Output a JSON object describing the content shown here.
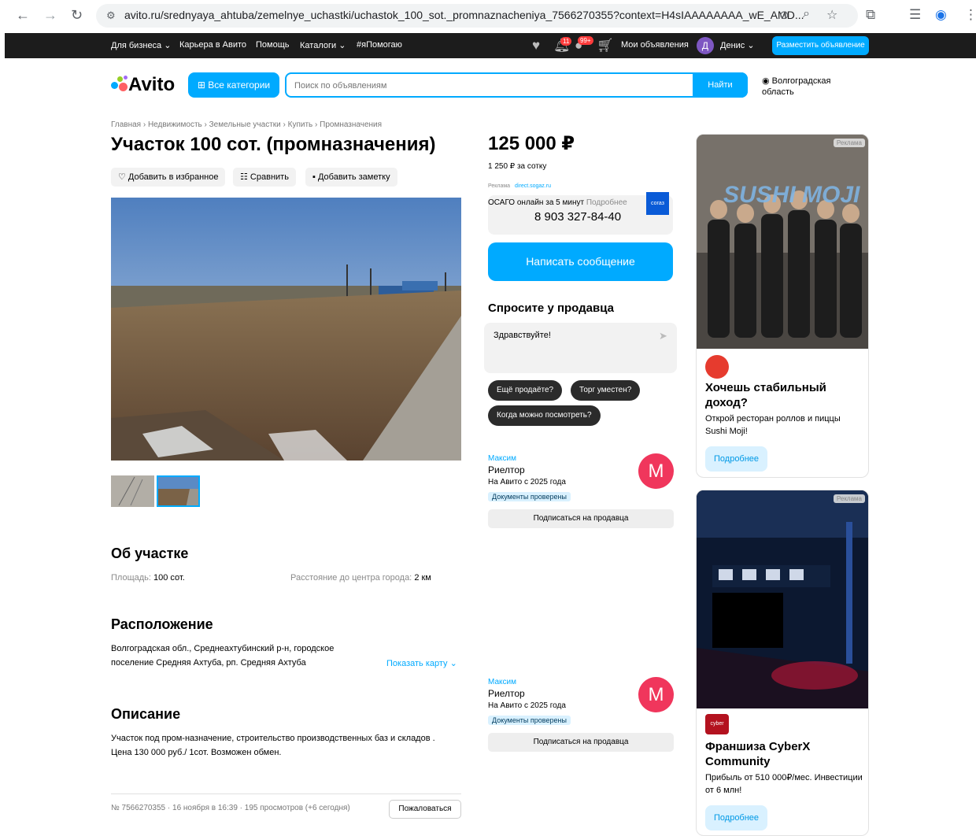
{
  "browser": {
    "url": "avito.ru/srednyaya_ahtuba/zemelnye_uchastki/uchastok_100_sot._promnaznacheniya_7566270355?context=H4sIAAAAAAAA_wE_AMD..."
  },
  "topbar": {
    "items": [
      "Для бизнеса ⌄",
      "Карьера в Авито",
      "Помощь",
      "Каталоги ⌄",
      "#яПомогаю"
    ],
    "notif_badge": "11",
    "msg_badge": "99+",
    "my_ads": "Мои объявления",
    "avatar_letter": "Д",
    "user": "Денис ⌄",
    "post_button": "Разместить объявление"
  },
  "header": {
    "logo": "Avito",
    "categories_button": "Все категории",
    "search_placeholder": "Поиск по объявлениям",
    "search_button": "Найти",
    "region": "Волгоградская область"
  },
  "listing": {
    "breadcrumb": "Главная › Недвижимость › Земельные участки › Купить › Промназначения",
    "title": "Участок 100 сот. (промназначения)",
    "actions": [
      "Добавить в избранное",
      "Сравнить",
      "Добавить заметку"
    ],
    "about_title": "Об участке",
    "area_label": "Площадь:",
    "area_value": "100 сот.",
    "distance_label": "Расстояние до центра города:",
    "distance_value": "2 км",
    "location_title": "Расположение",
    "address": "Волгоградская обл., Среднеахтубинский р-н, городское поселение Средняя Ахтуба, рп. Средняя Ахтуба",
    "show_map": "Показать карту ⌄",
    "description_title": "Описание",
    "description": "Участок под пром-назначение, строительство производственных баз и складов . Цена 130 000 руб./ 1сот. Возможен обмен.",
    "meta": "№ 7566270355 · 16 ноября в 16:39 · 195 просмотров (+6 сегодня)",
    "complain": "Пожаловаться"
  },
  "price": {
    "value": "125 000 ₽",
    "per_unit": "1 250 ₽ за сотку",
    "ad_label": "Реклама",
    "ad_domain": "direct.sogaz.ru",
    "ad_text": "ОСАГО онлайн за 5 минут",
    "ad_more": "Подробнее",
    "ad_logo": "согаз",
    "phone": "8 903 327-84-40",
    "message_button": "Написать сообщение",
    "ask_title": "Спросите у продавца",
    "ask_placeholder": "Здравствуйте!",
    "chips": [
      "Ещё продаёте?",
      "Торг уместен?",
      "Когда можно посмотреть?"
    ]
  },
  "seller": {
    "name": "Максим",
    "role": "Риелтор",
    "since": "На Авито с 2025 года",
    "docs": "Документы проверены",
    "avatar": "M",
    "subscribe": "Подписаться на продавца"
  },
  "ads": [
    {
      "tag": "Реклама",
      "image_text": "SUSHI MOJI",
      "title": "Хочешь стабильный доход?",
      "text": "Открой ресторан роллов и пиццы Sushi Moji!",
      "button": "Подробнее"
    },
    {
      "tag": "Реклама",
      "logo": "cyber",
      "title": "Франшиза CyberX Community",
      "text": "Прибыль от 510 000₽/мес. Инвестиции от 6 млн!",
      "button": "Подробнее"
    }
  ],
  "colors": {
    "accent": "#00aaff",
    "topbar": "#1c1c1c",
    "avatar": "#f0365c",
    "chip": "#2b2b2b"
  }
}
